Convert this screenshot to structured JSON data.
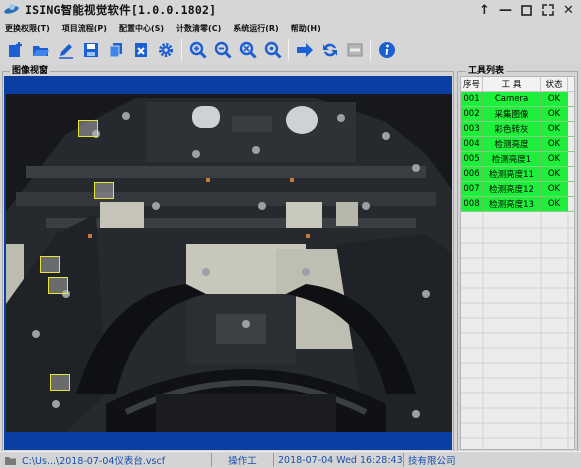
{
  "window": {
    "title": "ISING智能视觉软件[1.0.0.1802]"
  },
  "menu": [
    {
      "label": "更换权限(T)"
    },
    {
      "label": "项目流程(P)"
    },
    {
      "label": "配置中心(S)"
    },
    {
      "label": "计数清零(C)"
    },
    {
      "label": "系统运行(R)"
    },
    {
      "label": "帮助(H)"
    }
  ],
  "toolbar": {
    "icons": [
      "new-icon",
      "open-icon",
      "edit-icon",
      "save-icon",
      "copy-icon",
      "delete-icon",
      "settings-icon",
      "zoom-in-icon",
      "zoom-out-icon",
      "zoom-fit-icon",
      "zoom-reset-icon",
      "run-icon",
      "cycle-icon",
      "stop-icon",
      "info-icon"
    ]
  },
  "image_panel": {
    "title": "图像视窗"
  },
  "tool_panel": {
    "title": "工具列表",
    "headers": [
      "序号",
      "工 具",
      "状态"
    ],
    "rows": [
      [
        "001",
        "Camera",
        "OK"
      ],
      [
        "002",
        "采集图像",
        "OK"
      ],
      [
        "003",
        "彩色转灰",
        "OK"
      ],
      [
        "004",
        "检测亮度",
        "OK"
      ],
      [
        "005",
        "检测亮度1",
        "OK"
      ],
      [
        "006",
        "检测亮度11",
        "OK"
      ],
      [
        "007",
        "检测亮度12",
        "OK"
      ],
      [
        "008",
        "检测亮度13",
        "OK"
      ]
    ]
  },
  "status": {
    "file": "C:\\Us...\\2018-07-04仪表台.vscf",
    "user": "操作工",
    "datetime": "2018-07-04 Wed 16:28:43",
    "company": "技有限公司"
  },
  "colors": {
    "ok": "#1eef3a",
    "viewport": "#0a3ea2",
    "status_text": "#1a4fa8"
  }
}
